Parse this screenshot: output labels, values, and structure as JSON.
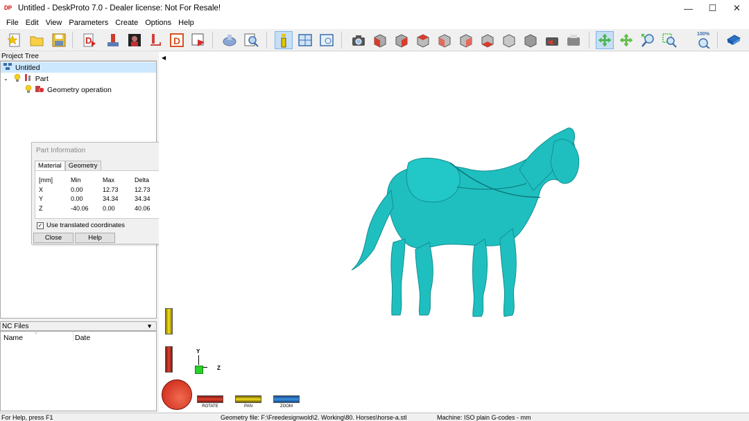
{
  "window": {
    "app_icon_text": "DP",
    "title": "Untitled - DeskProto 7.0 - Dealer license: Not For Resale!",
    "minimize": "—",
    "maximize": "☐",
    "close": "✕"
  },
  "menu": [
    "File",
    "Edit",
    "View",
    "Parameters",
    "Create",
    "Options",
    "Help"
  ],
  "toolbar": {
    "zoom_percent": "100%"
  },
  "project_tree": {
    "header": "Project Tree",
    "items": [
      {
        "label": "Untitled"
      },
      {
        "label": "Part"
      },
      {
        "label": "Geometry operation"
      }
    ]
  },
  "part_info": {
    "title": "Part Information",
    "tabs": [
      "Material",
      "Geometry"
    ],
    "table": {
      "headers": [
        "[mm]",
        "Min",
        "Max",
        "Delta"
      ],
      "rows": [
        [
          "X",
          "0.00",
          "12.73",
          "12.73"
        ],
        [
          "Y",
          "0.00",
          "34.34",
          "34.34"
        ],
        [
          "Z",
          "-40.06",
          "0.00",
          "40.06"
        ]
      ]
    },
    "checkbox_label": "Use translated coordinates",
    "close_label": "Close",
    "help_label": "Help"
  },
  "nc_files": {
    "header": "NC Files",
    "columns": [
      "Name",
      "Date"
    ]
  },
  "viewport": {
    "axis_y": "Y",
    "axis_z": "Z",
    "wheels": [
      "ROTATE",
      "PAN",
      "ZOOM"
    ]
  },
  "status": {
    "help": "For Help, press F1",
    "geometry": "Geometry file: F:\\Freedesignwold\\2. Working\\80. Horses\\horse-a.stl",
    "machine": "Machine: ISO plain G-codes - mm"
  },
  "colors": {
    "model": "#1fbfc0",
    "rotate_wheel": "#d63a2c",
    "pan_wheel": "#e6d21e",
    "zoom_wheel": "#2a7fd4",
    "selection": "#cce8ff"
  }
}
